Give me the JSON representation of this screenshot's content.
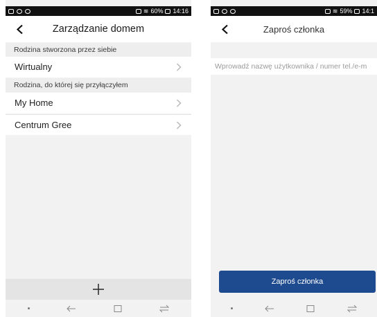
{
  "left_screen": {
    "status": {
      "battery": "60%",
      "time": "14:16"
    },
    "title": "Zarządzanie domem",
    "section_own": "Rodzina stworzona przez siebie",
    "own_families": [
      {
        "label": "Wirtualny"
      }
    ],
    "section_joined": "Rodzina, do której się przyłączyłem",
    "joined_families": [
      {
        "label": "My Home"
      },
      {
        "label": "Centrum Gree"
      }
    ],
    "add_icon": "plus-icon"
  },
  "right_screen": {
    "status": {
      "battery": "59%",
      "time": "14:1"
    },
    "title": "Zaproś członka",
    "input_placeholder": "Wprowadź nazwę użytkownika / numer tel./e-m",
    "input_value": "",
    "button_label": "Zaproś członka"
  },
  "colors": {
    "accent": "#1e4b8f",
    "background": "#f2f2f2",
    "section_background": "#eeeeee",
    "statusbar": "#111111"
  }
}
